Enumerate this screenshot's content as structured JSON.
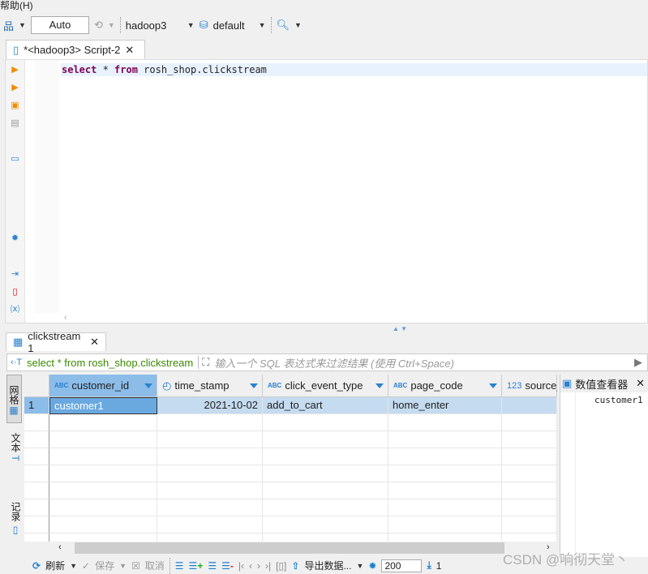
{
  "menu": {
    "help": "帮助(H)"
  },
  "toolbar": {
    "commit_mode": "Auto",
    "connection": "hadoop3",
    "schema": "default"
  },
  "editor": {
    "tab_title": "*<hadoop3> Script-2",
    "sql": "select * from rosh_shop.clickstream"
  },
  "results": {
    "tab_title": "clickstream 1",
    "query_text": "select * from rosh_shop.clickstream",
    "filter_placeholder": "输入一个 SQL 表达式来过滤结果 (使用 Ctrl+Space)",
    "side_tabs": {
      "grid": "网格",
      "text": "文本",
      "record": "记录"
    },
    "columns": [
      {
        "name": "customer_id",
        "type": "ABC"
      },
      {
        "name": "time_stamp",
        "type": "clock"
      },
      {
        "name": "click_event_type",
        "type": "ABC"
      },
      {
        "name": "page_code",
        "type": "ABC"
      },
      {
        "name": "source_",
        "type": "123"
      }
    ],
    "rows": [
      {
        "num": "1",
        "cells": [
          "customer1",
          "2021-10-02",
          "add_to_cart",
          "home_enter",
          ""
        ]
      }
    ]
  },
  "value_viewer": {
    "title": "数值查看器",
    "value": "customer1"
  },
  "bottom": {
    "refresh": "刷新",
    "save": "保存",
    "cancel": "取消",
    "export": "导出数据...",
    "fetch_size": "200",
    "count": "1"
  },
  "watermark": "CSDN @响彻天堂丶",
  "colors": {
    "selected_cell": "#6aa9e0",
    "selected_row": "#c5dbf0",
    "header_selected": "#8cbce8",
    "accent": "#2a82d0"
  }
}
